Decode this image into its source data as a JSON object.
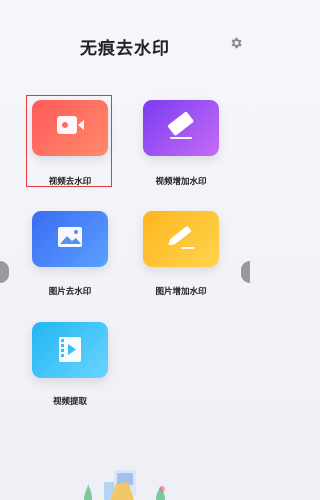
{
  "header": {
    "title": "无痕去水印",
    "settings_icon": "gear-icon"
  },
  "tools": [
    {
      "label": "视频去水印",
      "icon": "video-icon",
      "selected": true,
      "gradient": [
        "#ff5a5a",
        "#ff8b6b"
      ]
    },
    {
      "label": "视频增加水印",
      "icon": "eraser-icon",
      "selected": false,
      "gradient": [
        "#7b3cf0",
        "#c56cf5"
      ]
    },
    {
      "label": "图片去水印",
      "icon": "image-icon",
      "selected": false,
      "gradient": [
        "#3b6cf3",
        "#5aa0ff"
      ]
    },
    {
      "label": "图片增加水印",
      "icon": "pencil-icon",
      "selected": false,
      "gradient": [
        "#ffb51f",
        "#ffd44e"
      ]
    },
    {
      "label": "视频提取",
      "icon": "video-extract-icon",
      "selected": false,
      "gradient": [
        "#22b6f2",
        "#6ad4ff"
      ]
    }
  ],
  "colors": {
    "selection": "#e23a3a",
    "handle": "#9a9a9a"
  }
}
